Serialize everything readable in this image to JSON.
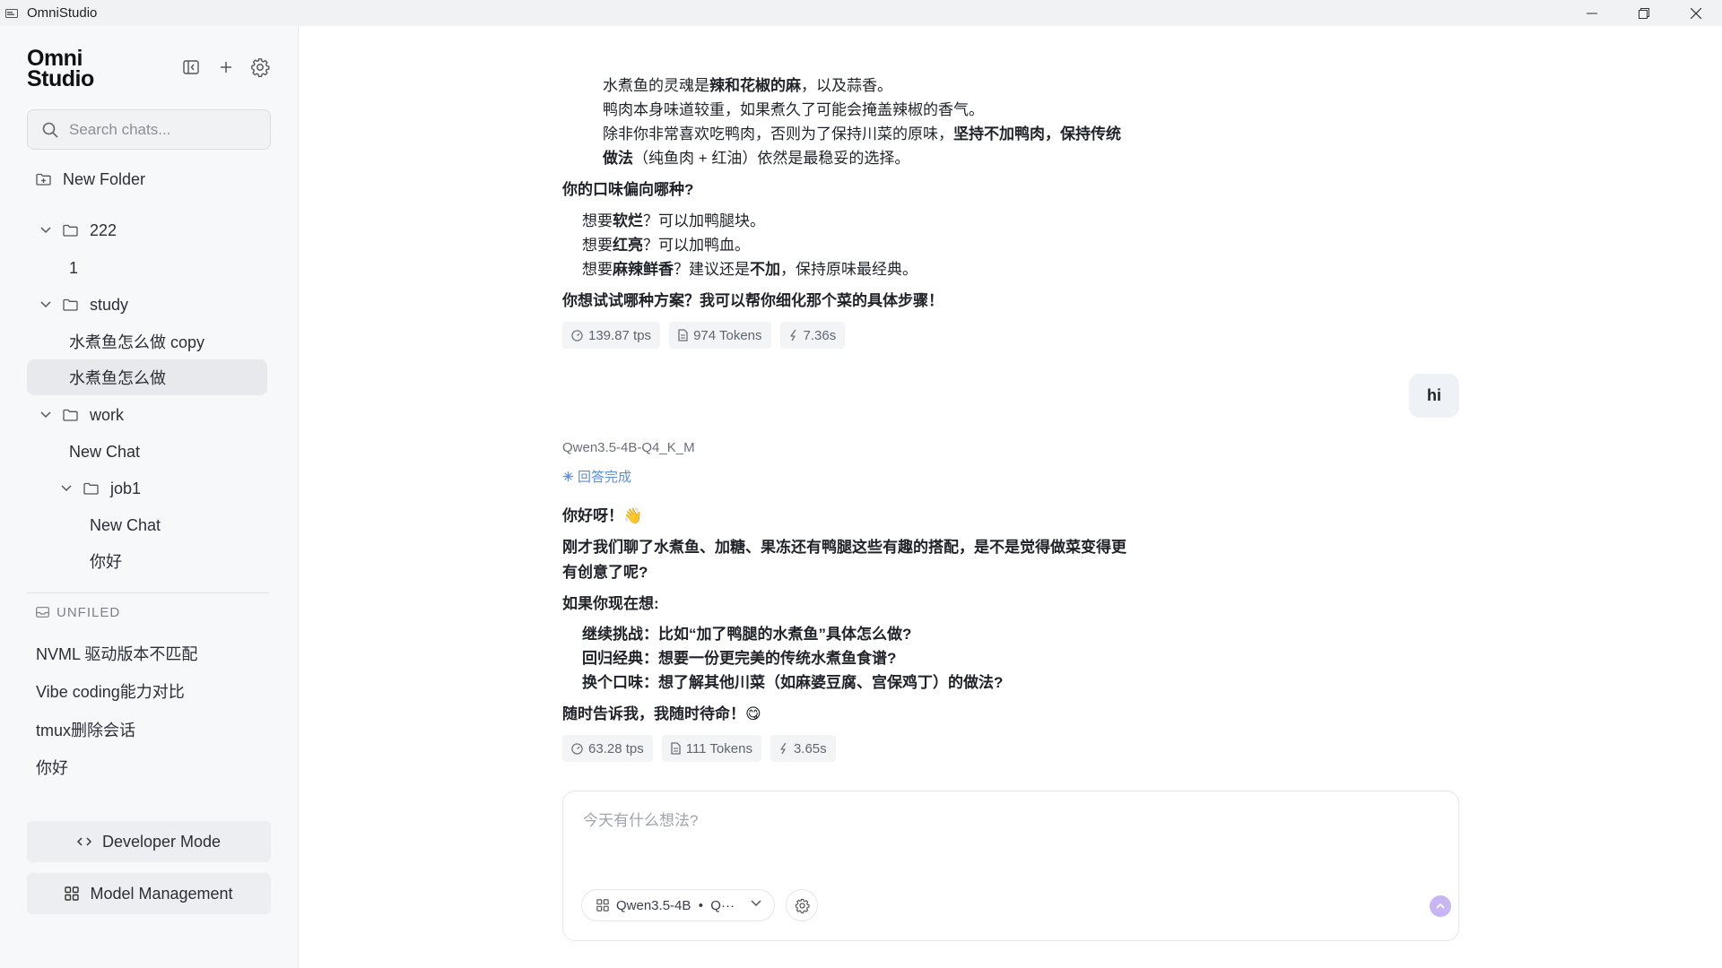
{
  "window": {
    "title": "OmniStudio"
  },
  "sidebar": {
    "logo_line1": "Omni",
    "logo_line2": "Studio",
    "search_placeholder": "Search chats...",
    "new_folder_label": "New Folder",
    "tree": {
      "folder_222": "222",
      "item_1": "1",
      "folder_study": "study",
      "item_study_copy": "水煮鱼怎么做 copy",
      "item_study_selected": "水煮鱼怎么做",
      "folder_work": "work",
      "item_work_new_chat": "New Chat",
      "folder_job1": "job1",
      "item_job1_new_chat": "New Chat",
      "item_job1_hello": "你好"
    },
    "unfiled_heading": "UNFILED",
    "unfiled_items": [
      "NVML 驱动版本不匹配",
      "Vibe coding能力对比",
      "tmux删除会话",
      "你好"
    ],
    "developer_mode_label": "Developer Mode",
    "model_management_label": "Model Management"
  },
  "chat": {
    "prev": {
      "l1_a": "水煮鱼的灵魂是",
      "l1_b": "辣和花椒的麻",
      "l1_c": "，以及蒜香。",
      "l2": "鸭肉本身味道较重，如果煮久了可能会掩盖辣椒的香气。",
      "l3_a": "除非你非常喜欢吃鸭肉，否则为了保持川菜的原味，",
      "l3_b": "坚持不加鸭肉，保持传统",
      "l4_a": "做法",
      "l4_b": "（纯鱼肉 + 红油）依然是最稳妥的选择。",
      "q_heading": "你的口味偏向哪种?",
      "b1_a": "想要",
      "b1_b": "软烂",
      "b1_c": "？可以加鸭腿块。",
      "b2_a": "想要",
      "b2_b": "红亮",
      "b2_c": "？可以加鸭血。",
      "b3_a": "想要",
      "b3_b": "麻辣鲜香",
      "b3_c": "？建议还是",
      "b3_d": "不加",
      "b3_e": "，保持原味最经典。",
      "closing": "你想试试哪种方案？我可以帮你细化那个菜的具体步骤！",
      "stats": {
        "tps": "139.87 tps",
        "tokens": "974 Tokens",
        "time": "7.36s"
      }
    },
    "user_message": "hi",
    "reply": {
      "model": "Qwen3.5-4B-Q4_K_M",
      "status": "回答完成",
      "greeting": "你好呀！👋",
      "p1_line1": "刚才我们聊了水煮鱼、加糖、果冻还有鸭腿这些有趣的搭配，是不是觉得做菜变得更",
      "p1_line2": "有创意了呢?",
      "p2": "如果你现在想:",
      "li1_a": "继续挑战",
      "li1_b": "：比如“加了鸭腿的水煮鱼”具体怎么做?",
      "li2_a": "回归经典",
      "li2_b": "：想要一份更完美的传统水煮鱼食谱?",
      "li3_a": "换个口味",
      "li3_b": "：想了解其他川菜（如麻婆豆腐、宫保鸡丁）的做法?",
      "closing": "随时告诉我，我随时待命！😋",
      "stats": {
        "tps": "63.28 tps",
        "tokens": "111 Tokens",
        "time": "3.65s"
      }
    }
  },
  "composer": {
    "placeholder": "今天有什么想法?",
    "model_label": "Qwen3.5-4B  •  Q···"
  },
  "colors": {
    "accent": "#c8b6f4",
    "status": "#5b8fd9",
    "sidebar_bg": "#f7f8fa"
  }
}
